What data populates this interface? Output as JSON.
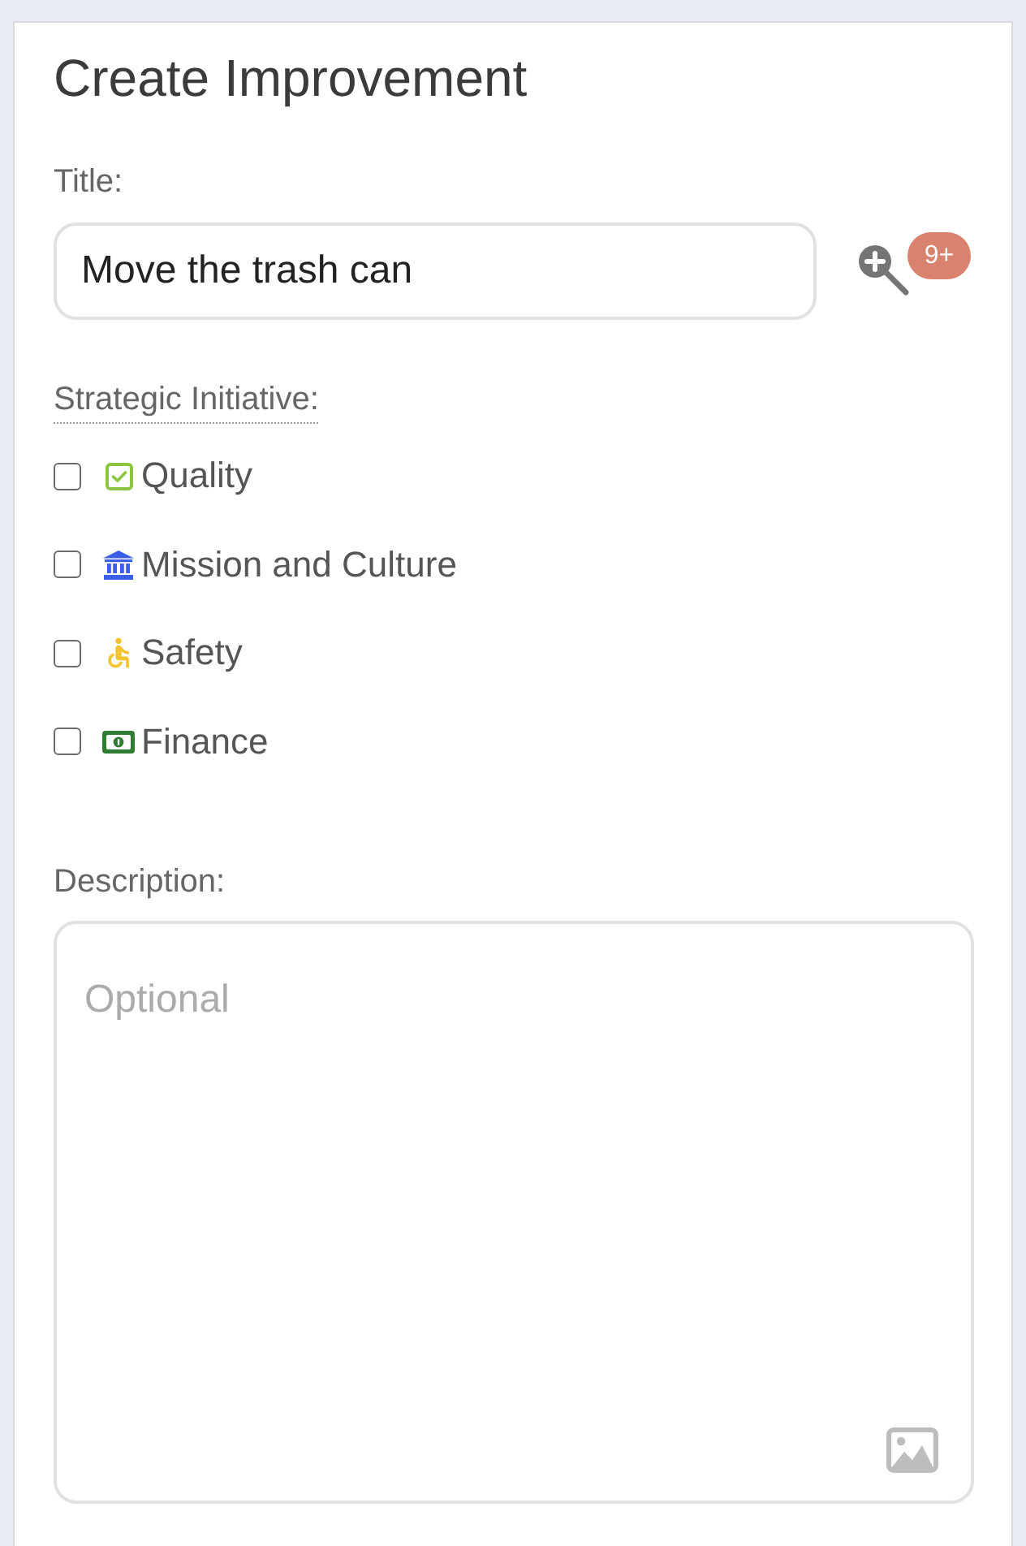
{
  "form": {
    "title": "Create Improvement"
  },
  "title_field": {
    "label": "Title:",
    "value": "Move the trash can",
    "badge": "9+"
  },
  "strategic_initiative": {
    "label": "Strategic Initiative:",
    "options": [
      {
        "kind": "check",
        "label": "Quality",
        "checked": false,
        "color": "#8cc63f"
      },
      {
        "kind": "bank",
        "label": "Mission and Culture",
        "checked": false,
        "color": "#3b5ee6"
      },
      {
        "kind": "wheelchair",
        "label": "Safety",
        "checked": false,
        "color": "#f4c430"
      },
      {
        "kind": "money",
        "label": "Finance",
        "checked": false,
        "color": "#2e7d32"
      }
    ]
  },
  "description": {
    "label": "Description:",
    "placeholder": "Optional"
  }
}
